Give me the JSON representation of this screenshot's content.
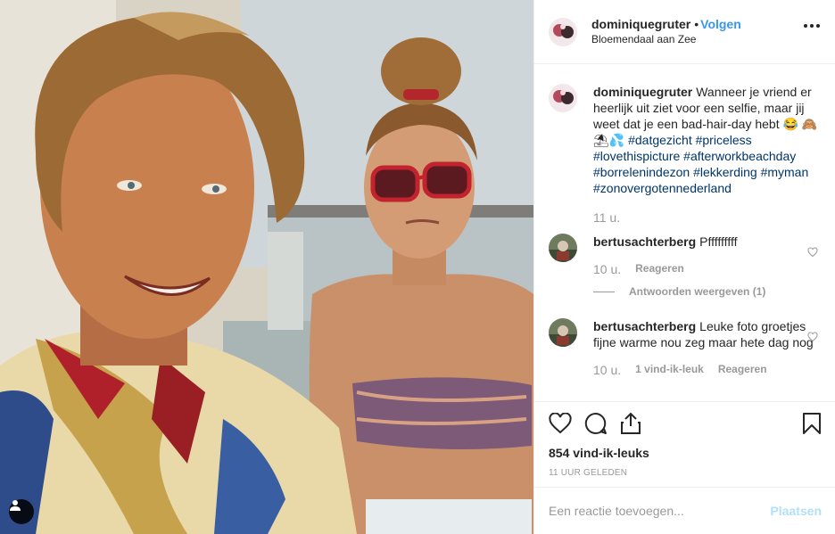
{
  "header": {
    "username": "dominiquegruter",
    "separator": "•",
    "follow_label": "Volgen",
    "location": "Bloemendaal aan Zee",
    "more_icon": "ellipsis-icon"
  },
  "caption": {
    "username": "dominiquegruter",
    "text": "Wanneer je vriend er heerlijk uit ziet voor een selfie, maar jij weet dat je een bad-hair-day hebt 😂 🙈⛱💦",
    "hashtags": "#datgezicht #priceless #lovethispicture #afterworkbeachday #borrelenindezon #lekkerding #myman #zonovergotennederland",
    "time": "11 u."
  },
  "comments": [
    {
      "username": "bertusachterberg",
      "text": "Pfffffffff",
      "time": "10 u.",
      "reply_label": "Reageren",
      "view_replies": "Antwoorden weergeven (1)"
    },
    {
      "username": "bertusachterberg",
      "text": "Leuke foto groetjes fijne warme nou zeg maar hete dag nog",
      "time": "10 u.",
      "likes_label": "1 vind-ik-leuk",
      "reply_label": "Reageren"
    }
  ],
  "actions": {
    "icons": [
      "heart-icon",
      "comment-icon",
      "share-icon",
      "bookmark-icon"
    ],
    "likes": "854 vind-ik-leuks",
    "posted": "11 UUR GELEDEN"
  },
  "add_comment": {
    "placeholder": "Een reactie toevoegen...",
    "post_label": "Plaatsen"
  },
  "colors": {
    "link": "#3897f0",
    "hashtag": "#003569",
    "muted": "#999999",
    "post_disabled": "#b2dffc"
  }
}
